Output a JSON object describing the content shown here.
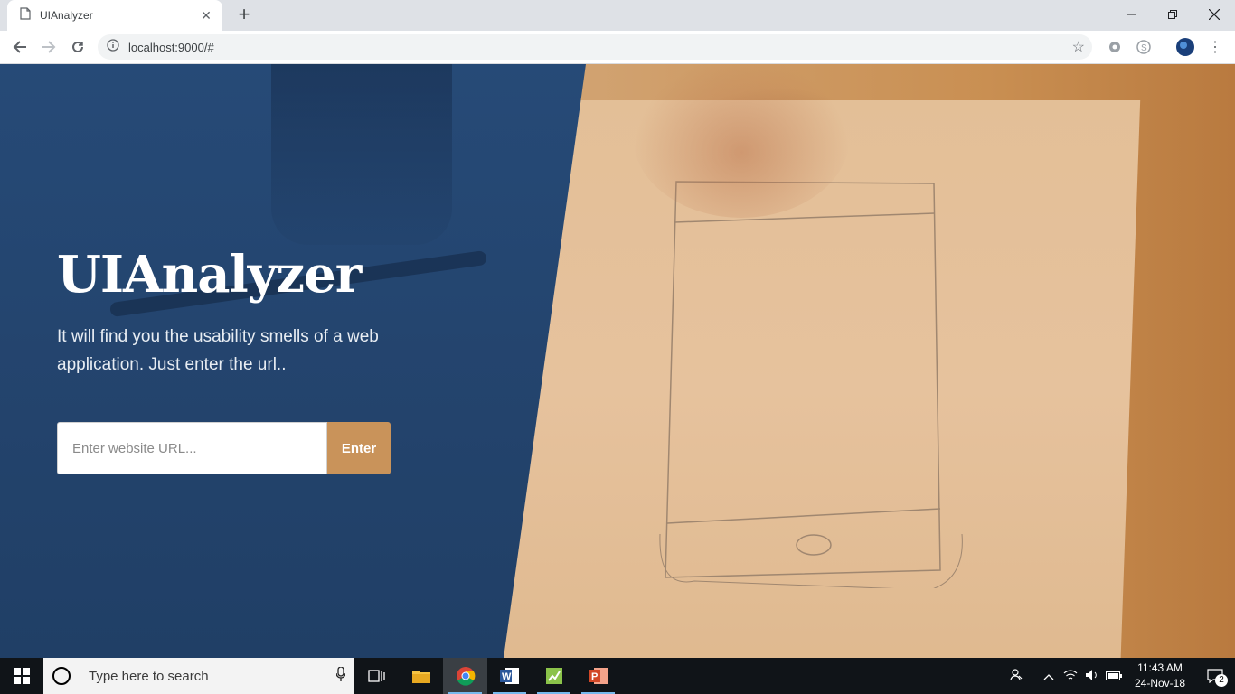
{
  "browser": {
    "tab_title": "UIAnalyzer",
    "tab_icon": "page-icon",
    "url": "localhost:9000/#",
    "window_controls": [
      "minimize",
      "restore",
      "close"
    ]
  },
  "page": {
    "title": "UIAnalyzer",
    "subtitle": "It will find you the usability smells of a web application. Just enter the url..",
    "url_input": {
      "value": "",
      "placeholder": "Enter website URL..."
    },
    "enter_label": "Enter",
    "colors": {
      "panel": "#244571",
      "accent": "#c9935a"
    }
  },
  "taskbar": {
    "search_placeholder": "Type here to search",
    "apps": [
      "task-view",
      "file-explorer",
      "chrome",
      "word",
      "project",
      "powerpoint"
    ],
    "clock_time": "11:43 AM",
    "clock_date": "24-Nov-18",
    "notification_count": "2"
  }
}
